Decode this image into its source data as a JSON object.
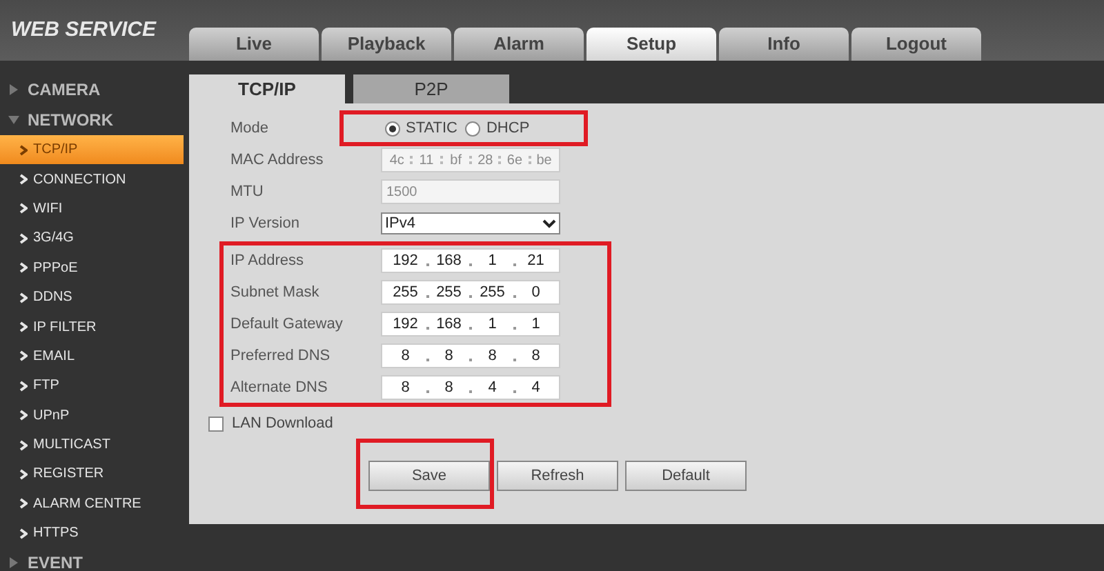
{
  "logo": {
    "text": "WEB SERVICE"
  },
  "tabs": [
    {
      "label": "Live",
      "selected": false
    },
    {
      "label": "Playback",
      "selected": false
    },
    {
      "label": "Alarm",
      "selected": false
    },
    {
      "label": "Setup",
      "selected": true
    },
    {
      "label": "Info",
      "selected": false
    },
    {
      "label": "Logout",
      "selected": false
    }
  ],
  "subtabs": [
    {
      "label": "TCP/IP",
      "selected": true
    },
    {
      "label": "P2P",
      "selected": false
    }
  ],
  "sidebar": {
    "items": [
      {
        "label": "CAMERA",
        "expanded": false
      },
      {
        "label": "NETWORK",
        "expanded": true,
        "children": [
          {
            "label": "TCP/IP",
            "selected": true
          },
          {
            "label": "CONNECTION",
            "selected": false
          },
          {
            "label": "WIFI",
            "selected": false
          },
          {
            "label": "3G/4G",
            "selected": false
          },
          {
            "label": "PPPoE",
            "selected": false
          },
          {
            "label": "DDNS",
            "selected": false
          },
          {
            "label": "IP FILTER",
            "selected": false
          },
          {
            "label": "EMAIL",
            "selected": false
          },
          {
            "label": "FTP",
            "selected": false
          },
          {
            "label": "UPnP",
            "selected": false
          },
          {
            "label": "MULTICAST",
            "selected": false
          },
          {
            "label": "REGISTER",
            "selected": false
          },
          {
            "label": "ALARM CENTRE",
            "selected": false
          },
          {
            "label": "HTTPS",
            "selected": false
          }
        ]
      },
      {
        "label": "EVENT",
        "expanded": false
      }
    ]
  },
  "form": {
    "rows": [
      {
        "kind": "radio",
        "label": "Mode",
        "highlighted": true,
        "options": [
          {
            "label": "STATIC",
            "selected": true
          },
          {
            "label": "DHCP",
            "selected": false
          }
        ]
      },
      {
        "kind": "mac",
        "label": "MAC Address",
        "disabled": true,
        "parts": [
          "4c",
          "11",
          "bf",
          "28",
          "6e",
          "be"
        ]
      },
      {
        "kind": "text",
        "label": "MTU",
        "disabled": true,
        "value": "1500"
      },
      {
        "kind": "select",
        "label": "IP Version",
        "value": "IPv4"
      },
      {
        "kind": "ip",
        "label": "IP Address",
        "highlighted": true,
        "parts": [
          "192",
          "168",
          "1",
          "21"
        ]
      },
      {
        "kind": "ip",
        "label": "Subnet Mask",
        "highlighted": true,
        "parts": [
          "255",
          "255",
          "255",
          "0"
        ]
      },
      {
        "kind": "ip",
        "label": "Default Gateway",
        "highlighted": true,
        "parts": [
          "192",
          "168",
          "1",
          "1"
        ]
      },
      {
        "kind": "ip",
        "label": "Preferred DNS",
        "highlighted": true,
        "parts": [
          "8",
          "8",
          "8",
          "8"
        ]
      },
      {
        "kind": "ip",
        "label": "Alternate DNS",
        "highlighted": true,
        "parts": [
          "8",
          "8",
          "4",
          "4"
        ]
      }
    ],
    "lan_download": {
      "label": "LAN Download",
      "checked": false
    },
    "buttons": [
      {
        "label": "Save",
        "highlighted": true
      },
      {
        "label": "Refresh",
        "highlighted": false
      },
      {
        "label": "Default",
        "highlighted": false
      }
    ]
  }
}
